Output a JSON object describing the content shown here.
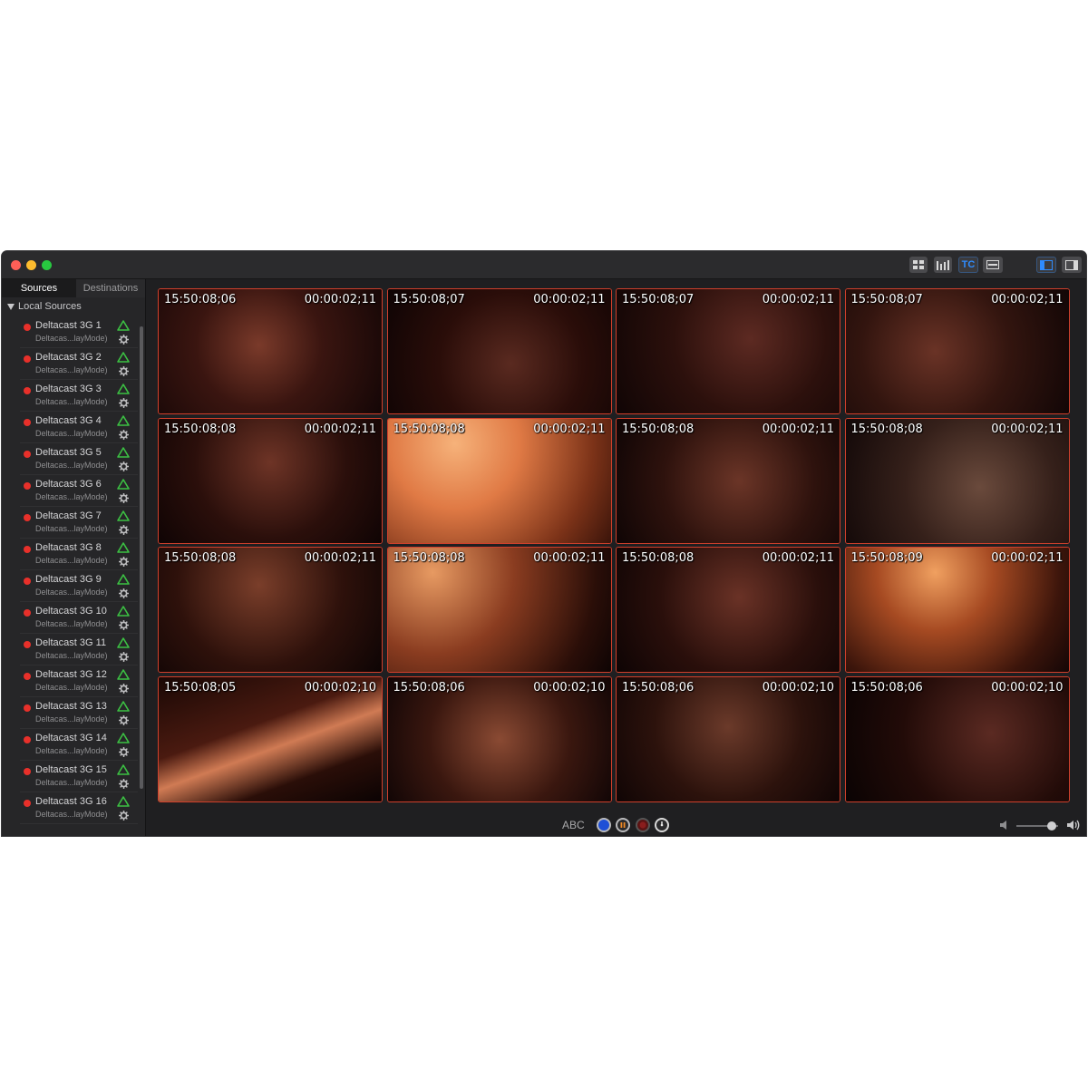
{
  "sidebar": {
    "tabs": [
      {
        "label": "Sources",
        "active": true
      },
      {
        "label": "Destinations",
        "active": false
      }
    ],
    "group_label": "Local Sources",
    "items": [
      {
        "name": "Deltacast 3G 1",
        "sub": "Deltacas...layMode)"
      },
      {
        "name": "Deltacast 3G 2",
        "sub": "Deltacas...layMode)"
      },
      {
        "name": "Deltacast 3G 3",
        "sub": "Deltacas...layMode)"
      },
      {
        "name": "Deltacast 3G 4",
        "sub": "Deltacas...layMode)"
      },
      {
        "name": "Deltacast 3G 5",
        "sub": "Deltacas...layMode)"
      },
      {
        "name": "Deltacast 3G 6",
        "sub": "Deltacas...layMode)"
      },
      {
        "name": "Deltacast 3G 7",
        "sub": "Deltacas...layMode)"
      },
      {
        "name": "Deltacast 3G 8",
        "sub": "Deltacas...layMode)"
      },
      {
        "name": "Deltacast 3G 9",
        "sub": "Deltacas...layMode)"
      },
      {
        "name": "Deltacast 3G 10",
        "sub": "Deltacas...layMode)"
      },
      {
        "name": "Deltacast 3G 11",
        "sub": "Deltacas...layMode)"
      },
      {
        "name": "Deltacast 3G 12",
        "sub": "Deltacas...layMode)"
      },
      {
        "name": "Deltacast 3G 13",
        "sub": "Deltacas...layMode)"
      },
      {
        "name": "Deltacast 3G 14",
        "sub": "Deltacas...layMode)"
      },
      {
        "name": "Deltacast 3G 15",
        "sub": "Deltacas...layMode)"
      },
      {
        "name": "Deltacast 3G 16",
        "sub": "Deltacas...layMode)"
      }
    ]
  },
  "toolbar": {
    "tc_label": "TC",
    "icons": [
      "grid-view-icon",
      "audio-meters-icon",
      "timecode-icon",
      "overlay-icon",
      "sidebar-left-icon",
      "sidebar-right-icon"
    ]
  },
  "tiles": [
    {
      "tc": "15:50:08;06",
      "dur": "00:00:02;11"
    },
    {
      "tc": "15:50:08;07",
      "dur": "00:00:02;11"
    },
    {
      "tc": "15:50:08;07",
      "dur": "00:00:02;11"
    },
    {
      "tc": "15:50:08;07",
      "dur": "00:00:02;11"
    },
    {
      "tc": "15:50:08;08",
      "dur": "00:00:02;11"
    },
    {
      "tc": "15:50:08;08",
      "dur": "00:00:02;11"
    },
    {
      "tc": "15:50:08;08",
      "dur": "00:00:02;11"
    },
    {
      "tc": "15:50:08;08",
      "dur": "00:00:02;11"
    },
    {
      "tc": "15:50:08;08",
      "dur": "00:00:02;11"
    },
    {
      "tc": "15:50:08;08",
      "dur": "00:00:02;11"
    },
    {
      "tc": "15:50:08;08",
      "dur": "00:00:02;11"
    },
    {
      "tc": "15:50:08;09",
      "dur": "00:00:02;11"
    },
    {
      "tc": "15:50:08;05",
      "dur": "00:00:02;10"
    },
    {
      "tc": "15:50:08;06",
      "dur": "00:00:02;10"
    },
    {
      "tc": "15:50:08;06",
      "dur": "00:00:02;10"
    },
    {
      "tc": "15:50:08;06",
      "dur": "00:00:02;10"
    }
  ],
  "bottom": {
    "abc_label": "ABC",
    "volume_level": 0.85
  },
  "colors": {
    "tile_border": "#d0402c",
    "source_status": "#e8302a",
    "signal_ok": "#3cc043",
    "accent": "#2f8cff"
  }
}
